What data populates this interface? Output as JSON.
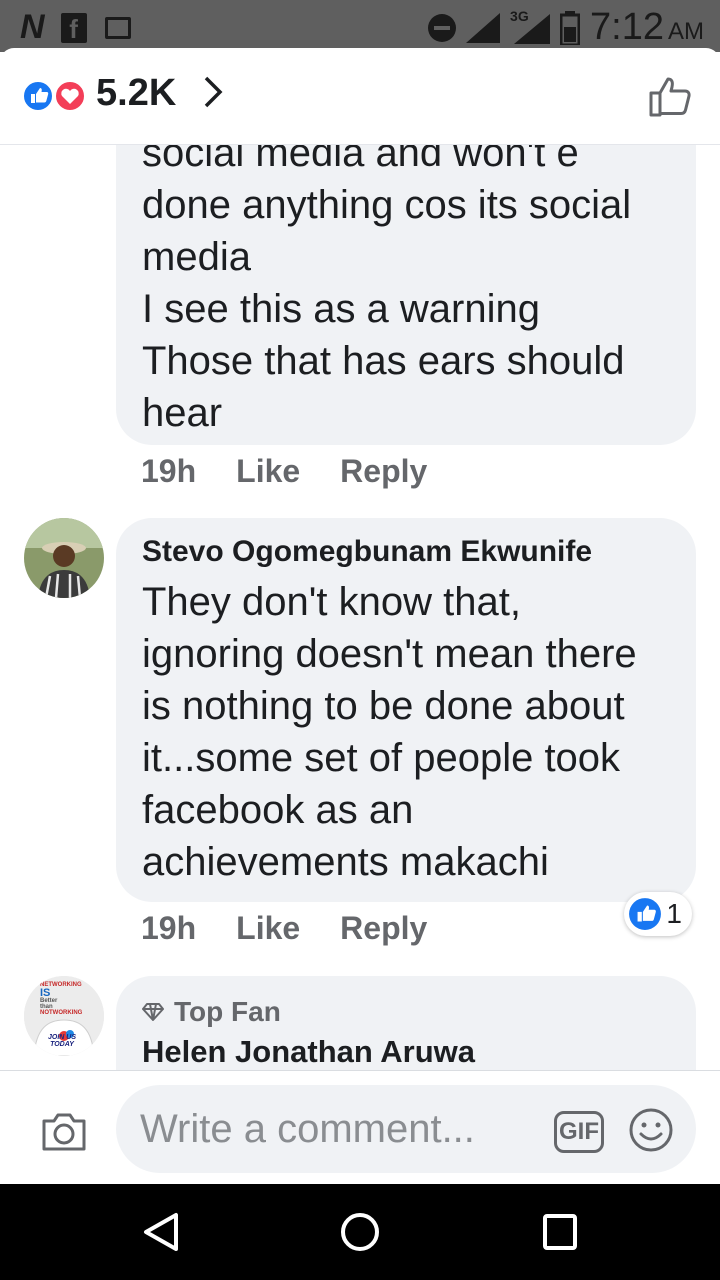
{
  "status_bar": {
    "left_icons": [
      "n-app-icon",
      "facebook-icon",
      "gallery-icon"
    ],
    "network": "3G",
    "time": "7:12",
    "ampm": "AM"
  },
  "header": {
    "reaction_icons": [
      "like-icon",
      "love-icon"
    ],
    "reaction_count": "5.2K"
  },
  "comments": [
    {
      "text": "social media and won't e\ndone anything cos its social\nmedia\nI see this as a warning\nThose that has ears should\nhear",
      "time": "19h",
      "like": "Like",
      "reply": "Reply"
    },
    {
      "author": "Stevo Ogomegbunam Ekwunife",
      "text": "They don't know that,\nignoring  doesn't mean there\nis nothing to be done about\nit...some set of people took\nfacebook as an\nachievements makachi",
      "time": "19h",
      "like": "Like",
      "reply": "Reply",
      "reaction_count": "1"
    },
    {
      "badge": "Top Fan",
      "author": "Helen Jonathan Aruwa",
      "avatar_text": [
        "NETWORKING",
        "IS",
        "Better",
        "than",
        "NOTWORKING",
        "JOIN US",
        "TODAY"
      ]
    }
  ],
  "composer": {
    "placeholder": "Write a comment...",
    "gif_label": "GIF"
  },
  "colors": {
    "facebook_blue": "#1877f2",
    "love_red": "#f33e58",
    "bubble_bg": "#f0f2f5",
    "meta_gray": "#65676b"
  }
}
